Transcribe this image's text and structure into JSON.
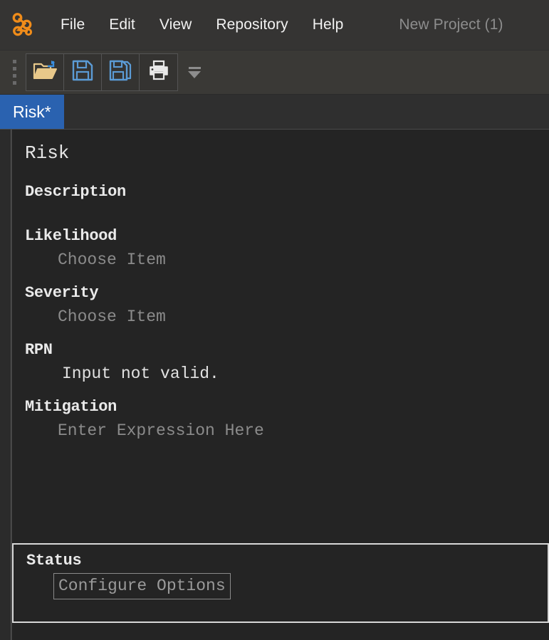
{
  "window": {
    "project_label": "New Project (1)",
    "logo_icon": "node-graph-logo-icon",
    "accent_color": "#2a62b0",
    "logo_color": "#f08c1a",
    "background_color": "#242424"
  },
  "menubar": {
    "items": [
      {
        "label": "File",
        "name": "menu-file"
      },
      {
        "label": "Edit",
        "name": "menu-edit"
      },
      {
        "label": "View",
        "name": "menu-view"
      },
      {
        "label": "Repository",
        "name": "menu-repository"
      },
      {
        "label": "Help",
        "name": "menu-help"
      }
    ]
  },
  "toolbar": {
    "buttons": [
      {
        "icon": "open-folder-icon",
        "name": "open-button",
        "color": "#e8c88a"
      },
      {
        "icon": "save-floppy-icon",
        "name": "save-button",
        "color": "#5b9bd5"
      },
      {
        "icon": "save-as-floppy-icon",
        "name": "save-as-button",
        "color": "#5b9bd5"
      },
      {
        "icon": "print-icon",
        "name": "print-button",
        "color": "#e8e8e8"
      }
    ],
    "overflow_icon": "toolbar-overflow-chevron-icon",
    "grip_icon": "toolbar-grip-icon"
  },
  "tabs": [
    {
      "label": "Risk*",
      "name": "tab-risk",
      "active": true
    }
  ],
  "form": {
    "heading": "Risk",
    "fields": [
      {
        "label": "Description",
        "value": "",
        "kind": "text",
        "name": "description"
      },
      {
        "label": "Likelihood",
        "value": "Choose Item",
        "kind": "placeholder",
        "name": "likelihood"
      },
      {
        "label": "Severity",
        "value": "Choose Item",
        "kind": "placeholder",
        "name": "severity"
      },
      {
        "label": "RPN",
        "value": "Input not valid.",
        "kind": "value",
        "name": "rpn"
      },
      {
        "label": "Mitigation",
        "value": "Enter Expression Here",
        "kind": "placeholder",
        "name": "mitigation"
      }
    ]
  },
  "status": {
    "label": "Status",
    "configure_label": "Configure Options"
  }
}
